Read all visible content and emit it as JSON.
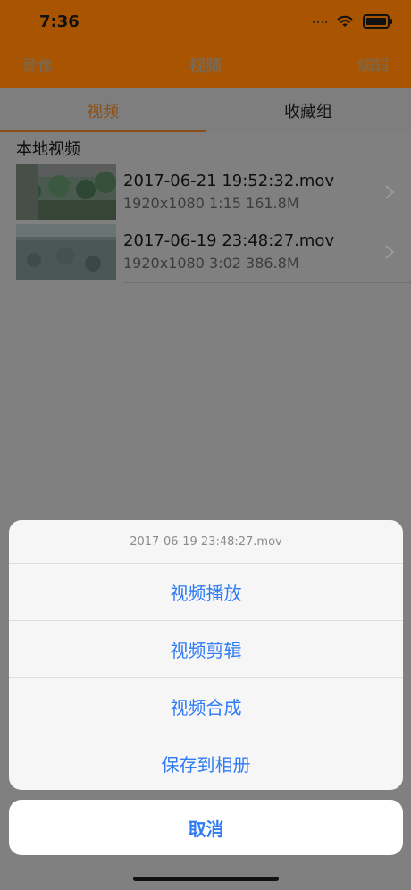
{
  "status": {
    "time": "7:36"
  },
  "nav": {
    "left": "录像",
    "title": "视频",
    "right": "编辑"
  },
  "tabs": [
    {
      "label": "视频"
    },
    {
      "label": "收藏组"
    }
  ],
  "section": {
    "title": "本地视频"
  },
  "videos": [
    {
      "title": "2017-06-21 19:52:32.mov",
      "meta": "1920x1080  1:15  161.8M"
    },
    {
      "title": "2017-06-19 23:48:27.mov",
      "meta": "1920x1080  3:02  386.8M"
    }
  ],
  "action_sheet": {
    "title": "2017-06-19 23:48:27.mov",
    "items": [
      {
        "label": "视频播放"
      },
      {
        "label": "视频剪辑"
      },
      {
        "label": "视频合成"
      },
      {
        "label": "保存到相册"
      }
    ],
    "cancel": "取消"
  }
}
